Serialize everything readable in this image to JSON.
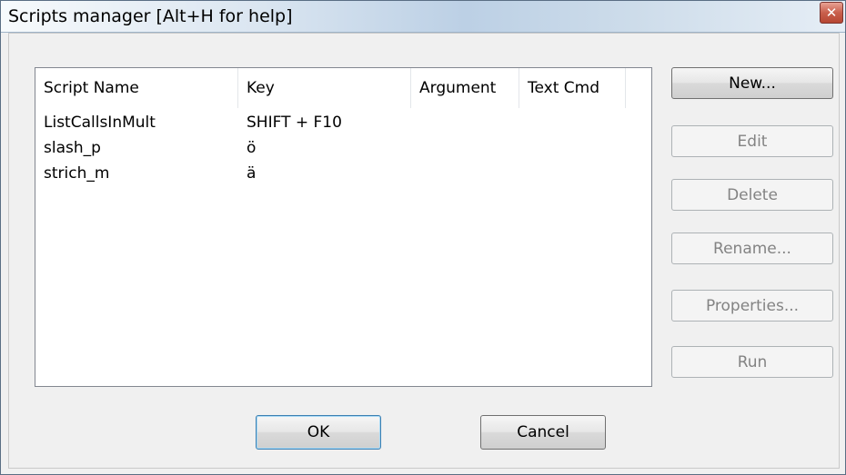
{
  "window": {
    "title": "Scripts manager [Alt+H for help]",
    "close_glyph": "✕"
  },
  "list": {
    "columns": [
      "Script Name",
      "Key",
      "Argument",
      "Text Cmd"
    ],
    "rows": [
      {
        "name": "ListCallsInMult",
        "key": "SHIFT + F10",
        "argument": "",
        "text_cmd": ""
      },
      {
        "name": "slash_p",
        "key": "ö",
        "argument": "",
        "text_cmd": ""
      },
      {
        "name": "strich_m",
        "key": "ä",
        "argument": "",
        "text_cmd": ""
      }
    ]
  },
  "side_buttons": {
    "new": "New...",
    "edit": "Edit",
    "delete": "Delete",
    "rename": "Rename...",
    "properties": "Properties...",
    "run": "Run"
  },
  "footer_buttons": {
    "ok": "OK",
    "cancel": "Cancel"
  }
}
